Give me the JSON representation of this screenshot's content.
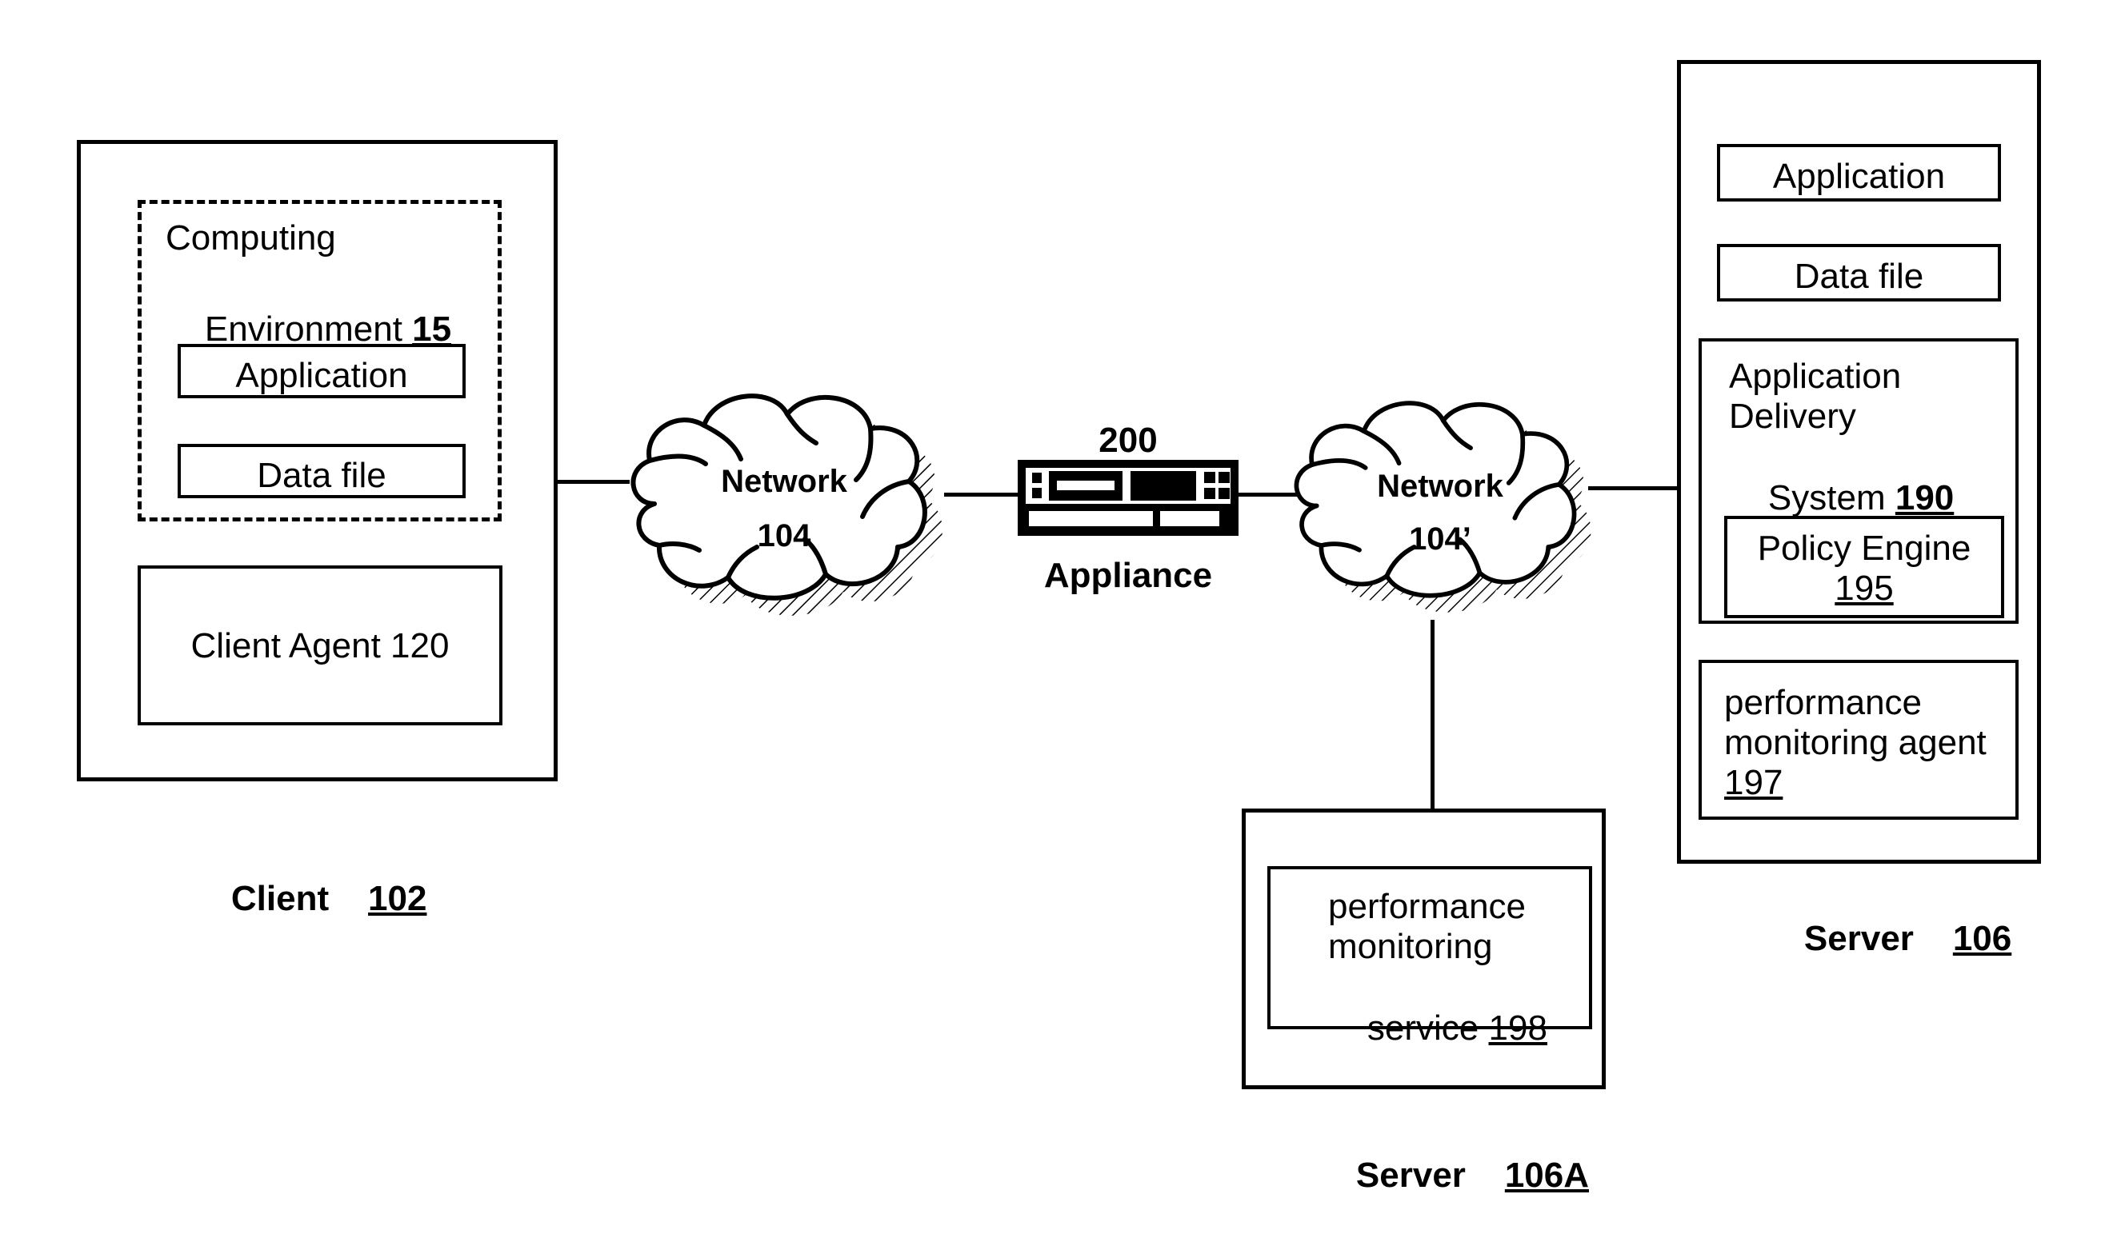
{
  "diagram": {
    "title": "Network architecture with client, networks, appliance and servers",
    "stroke_color": "#000000",
    "background_color": "#ffffff"
  },
  "client": {
    "label_name": "Client",
    "label_ref": "102",
    "computing_environment": {
      "title_line1": "Computing",
      "title_line2": "Environment",
      "ref": "15",
      "items": [
        {
          "label": "Application"
        },
        {
          "label": "Data file"
        }
      ]
    },
    "client_agent": {
      "label": "Client Agent 120"
    }
  },
  "network_left": {
    "name": "Network",
    "ref": "104"
  },
  "appliance": {
    "ref": "200",
    "label": "Appliance"
  },
  "network_right": {
    "name": "Network",
    "ref": "104’"
  },
  "server": {
    "label_name": "Server",
    "label_ref": "106",
    "items": [
      {
        "label": "Application"
      },
      {
        "label": "Data file"
      }
    ],
    "application_delivery_system": {
      "line1": "Application",
      "line2": "Delivery",
      "line3": "System",
      "ref": "190",
      "policy_engine": {
        "label": "Policy Engine",
        "ref": "195"
      }
    },
    "performance_monitoring_agent": {
      "line1": "performance",
      "line2": "monitoring agent",
      "ref": "197"
    }
  },
  "server_a": {
    "label_name": "Server",
    "label_ref": "106A",
    "performance_monitoring_service": {
      "line1": "performance",
      "line2": "monitoring",
      "line3": "service",
      "ref": "198"
    }
  }
}
